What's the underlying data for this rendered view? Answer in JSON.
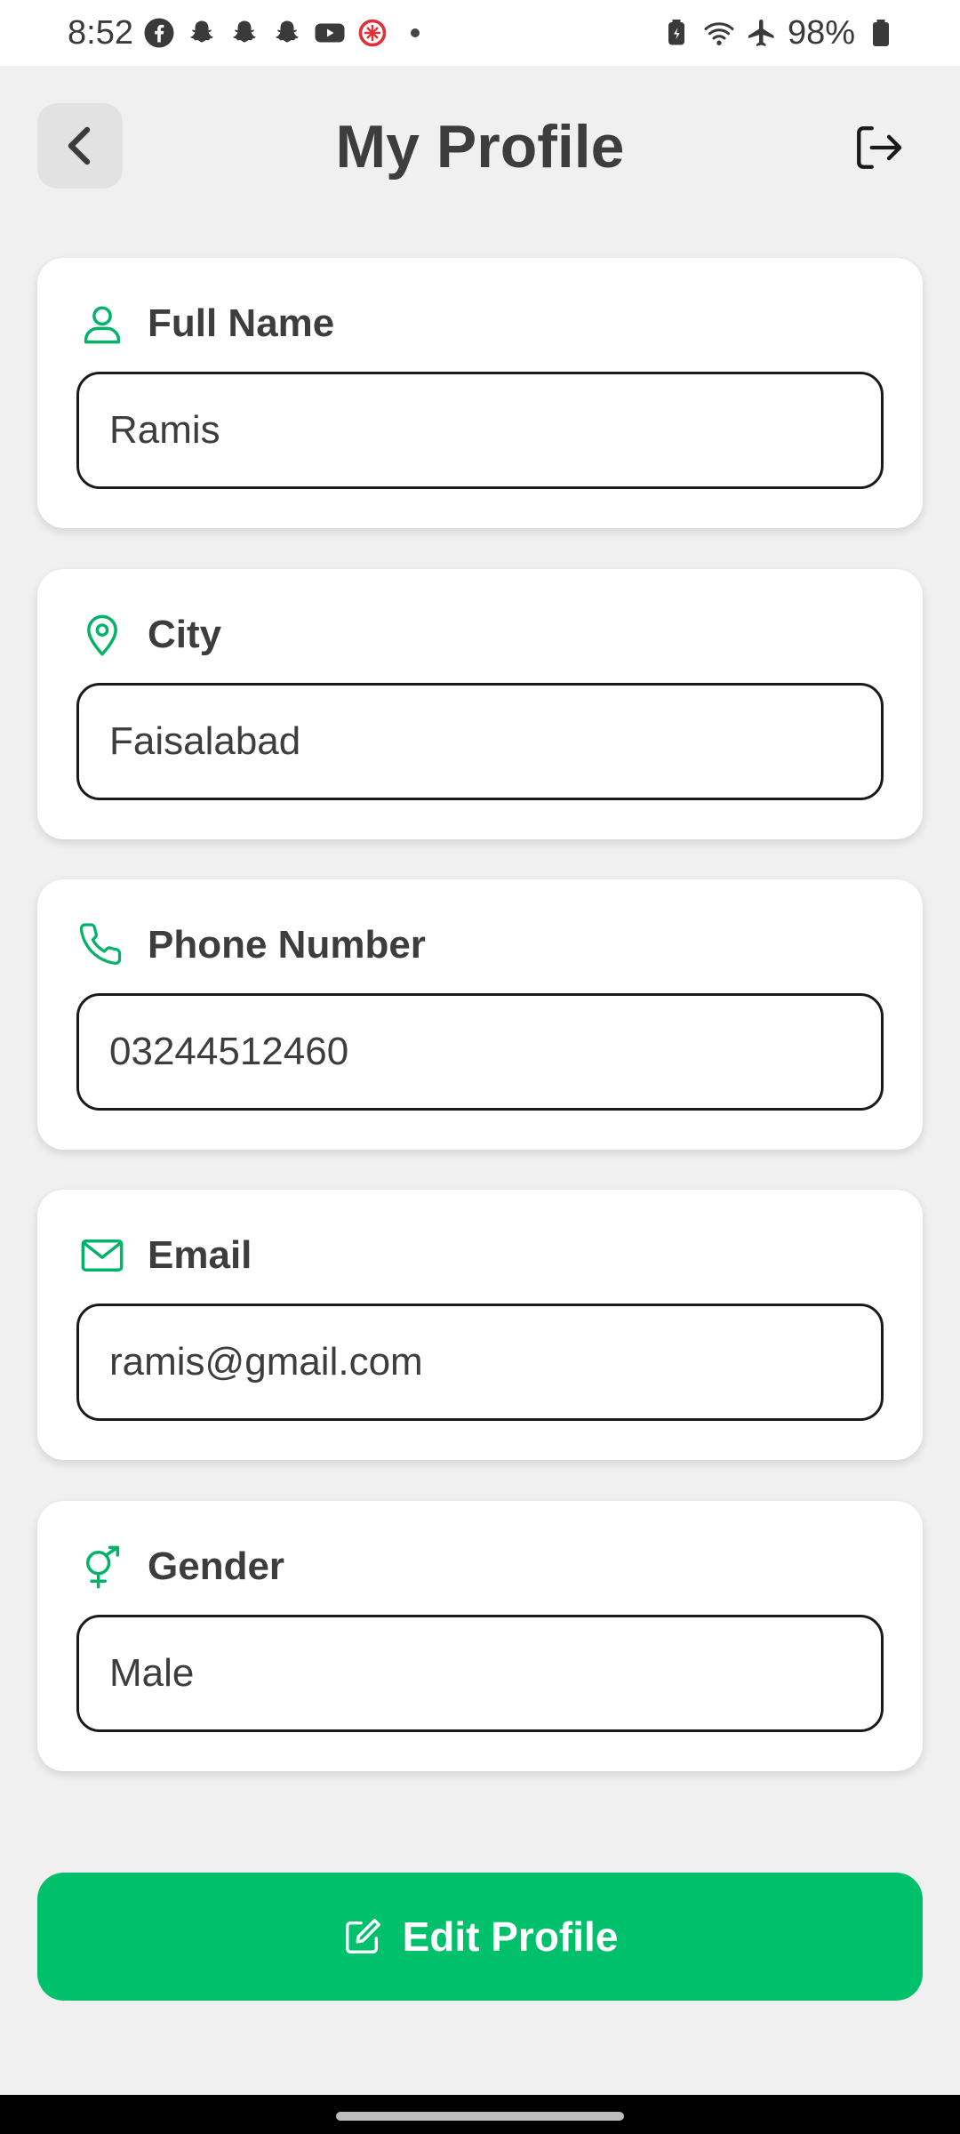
{
  "status_bar": {
    "time": "8:52",
    "battery": "98%",
    "left_icons": [
      "facebook-icon",
      "snapchat-icon",
      "snapchat-icon",
      "snapchat-icon",
      "youtube-icon",
      "app-icon"
    ],
    "right_icons": [
      "battery-saver-icon",
      "wifi-icon",
      "airplane-icon",
      "battery-icon"
    ]
  },
  "header": {
    "title": "My Profile",
    "back_icon": "chevron-left-icon",
    "logout_icon": "logout-icon"
  },
  "fields": [
    {
      "label": "Full Name",
      "value": "Ramis",
      "icon": "person-icon"
    },
    {
      "label": "City",
      "value": "Faisalabad",
      "icon": "location-pin-icon"
    },
    {
      "label": "Phone Number",
      "value": "03244512460",
      "icon": "phone-icon"
    },
    {
      "label": "Email",
      "value": "ramis@gmail.com",
      "icon": "mail-icon"
    },
    {
      "label": "Gender",
      "value": "Male",
      "icon": "gender-icon"
    }
  ],
  "edit_button": {
    "label": "Edit Profile",
    "icon": "edit-icon"
  },
  "colors": {
    "accent": "#00c06c",
    "background": "#f0f0f0",
    "card": "#ffffff",
    "text": "#3d3d3d"
  }
}
